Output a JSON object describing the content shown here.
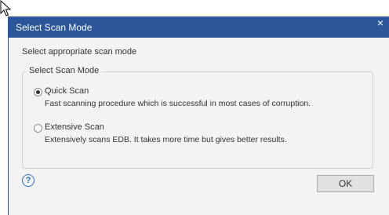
{
  "cursor": {
    "icon": "arrow-cursor-icon"
  },
  "dialog": {
    "title": "Select Scan Mode",
    "close_icon": "×",
    "instruction": "Select appropriate scan mode",
    "group_label": "Select Scan Mode",
    "options": [
      {
        "label": "Quick Scan",
        "description": "Fast scanning procedure which is successful in most cases of corruption.",
        "selected": true
      },
      {
        "label": "Extensive Scan",
        "description": "Extensively scans EDB. It takes more time but gives better results.",
        "selected": false
      }
    ],
    "help_icon": "?",
    "ok_label": "OK"
  },
  "colors": {
    "titlebar": "#2b579a",
    "body_background": "#f3f3f3",
    "help_icon": "#2b6cc4"
  }
}
